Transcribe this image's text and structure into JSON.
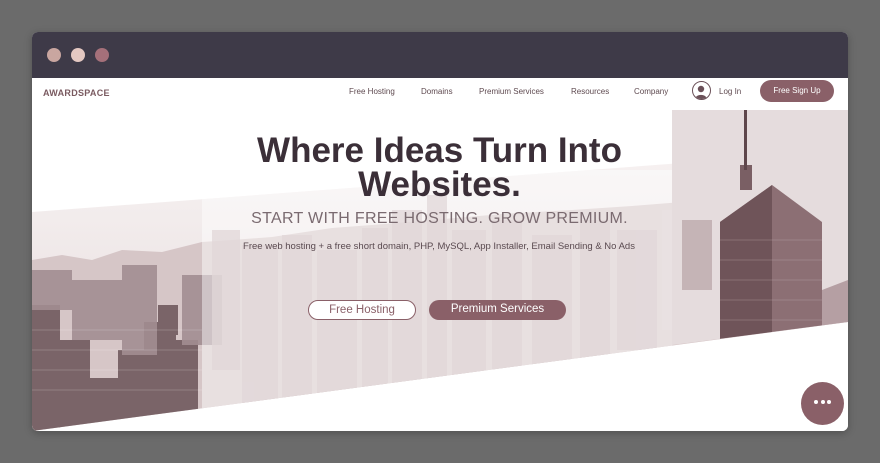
{
  "nav": {
    "logo": "AWARDSPACE",
    "links": [
      {
        "label": "Free Hosting"
      },
      {
        "label": "Domains"
      },
      {
        "label": "Premium Services"
      },
      {
        "label": "Resources"
      },
      {
        "label": "Company"
      }
    ],
    "login": "Log In",
    "signup": "Free Sign Up"
  },
  "hero": {
    "headline_line1": "Where Ideas Turn Into",
    "headline_line2": "Websites.",
    "subtitle": "START WITH FREE HOSTING. GROW PREMIUM.",
    "description": "Free web hosting + a free short domain, PHP, MySQL, App Installer, Email Sending & No Ads",
    "btn_free": "Free Hosting",
    "btn_premium": "Premium Services"
  },
  "colors": {
    "brand": "#8a6068",
    "titlebar": "#3e3a48",
    "headline": "#3b2f38"
  }
}
